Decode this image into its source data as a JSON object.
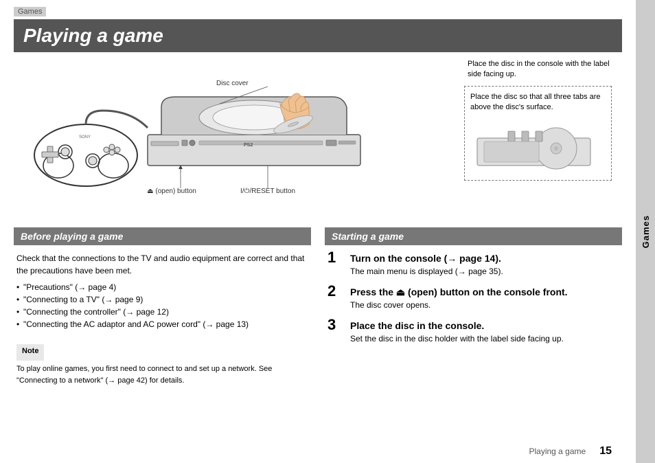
{
  "page": {
    "games_label": "Games",
    "title": "Playing a game",
    "side_tab": "Games",
    "page_number": "15",
    "footer_text": "Playing a game"
  },
  "diagram": {
    "disc_cover_label": "Disc cover",
    "open_button_label": "⏏ (open) button",
    "reset_button_label": "I/⏻/RESET button",
    "disc_label_caption": "Place the disc in the console with the label side facing up.",
    "disc_tabs_caption": "Place the disc so that all three tabs are above the disc's surface."
  },
  "before_section": {
    "header": "Before playing a game",
    "intro": "Check that the connections to the TV and audio equipment are correct and that the precautions have been met.",
    "bullets": [
      "\"Precautions\" (→ page 4)",
      "\"Connecting to a TV\" (→ page 9)",
      "\"Connecting the controller\" (→ page 12)",
      "\"Connecting the AC adaptor and AC power cord\" (→ page 13)"
    ],
    "note_label": "Note",
    "note_text": "To play online games, you first need to connect to and set up a network. See \"Connecting to a network\" (→ page 42) for details."
  },
  "starting_section": {
    "header": "Starting a game",
    "steps": [
      {
        "number": "1",
        "title": "Turn on the console (→ page 14).",
        "desc": "The main menu is displayed (→ page 35)."
      },
      {
        "number": "2",
        "title": "Press the ⏏ (open) button on the console front.",
        "desc": "The disc cover opens."
      },
      {
        "number": "3",
        "title": "Place the disc in the console.",
        "desc": "Set the disc in the disc holder with the label side facing up."
      }
    ]
  }
}
